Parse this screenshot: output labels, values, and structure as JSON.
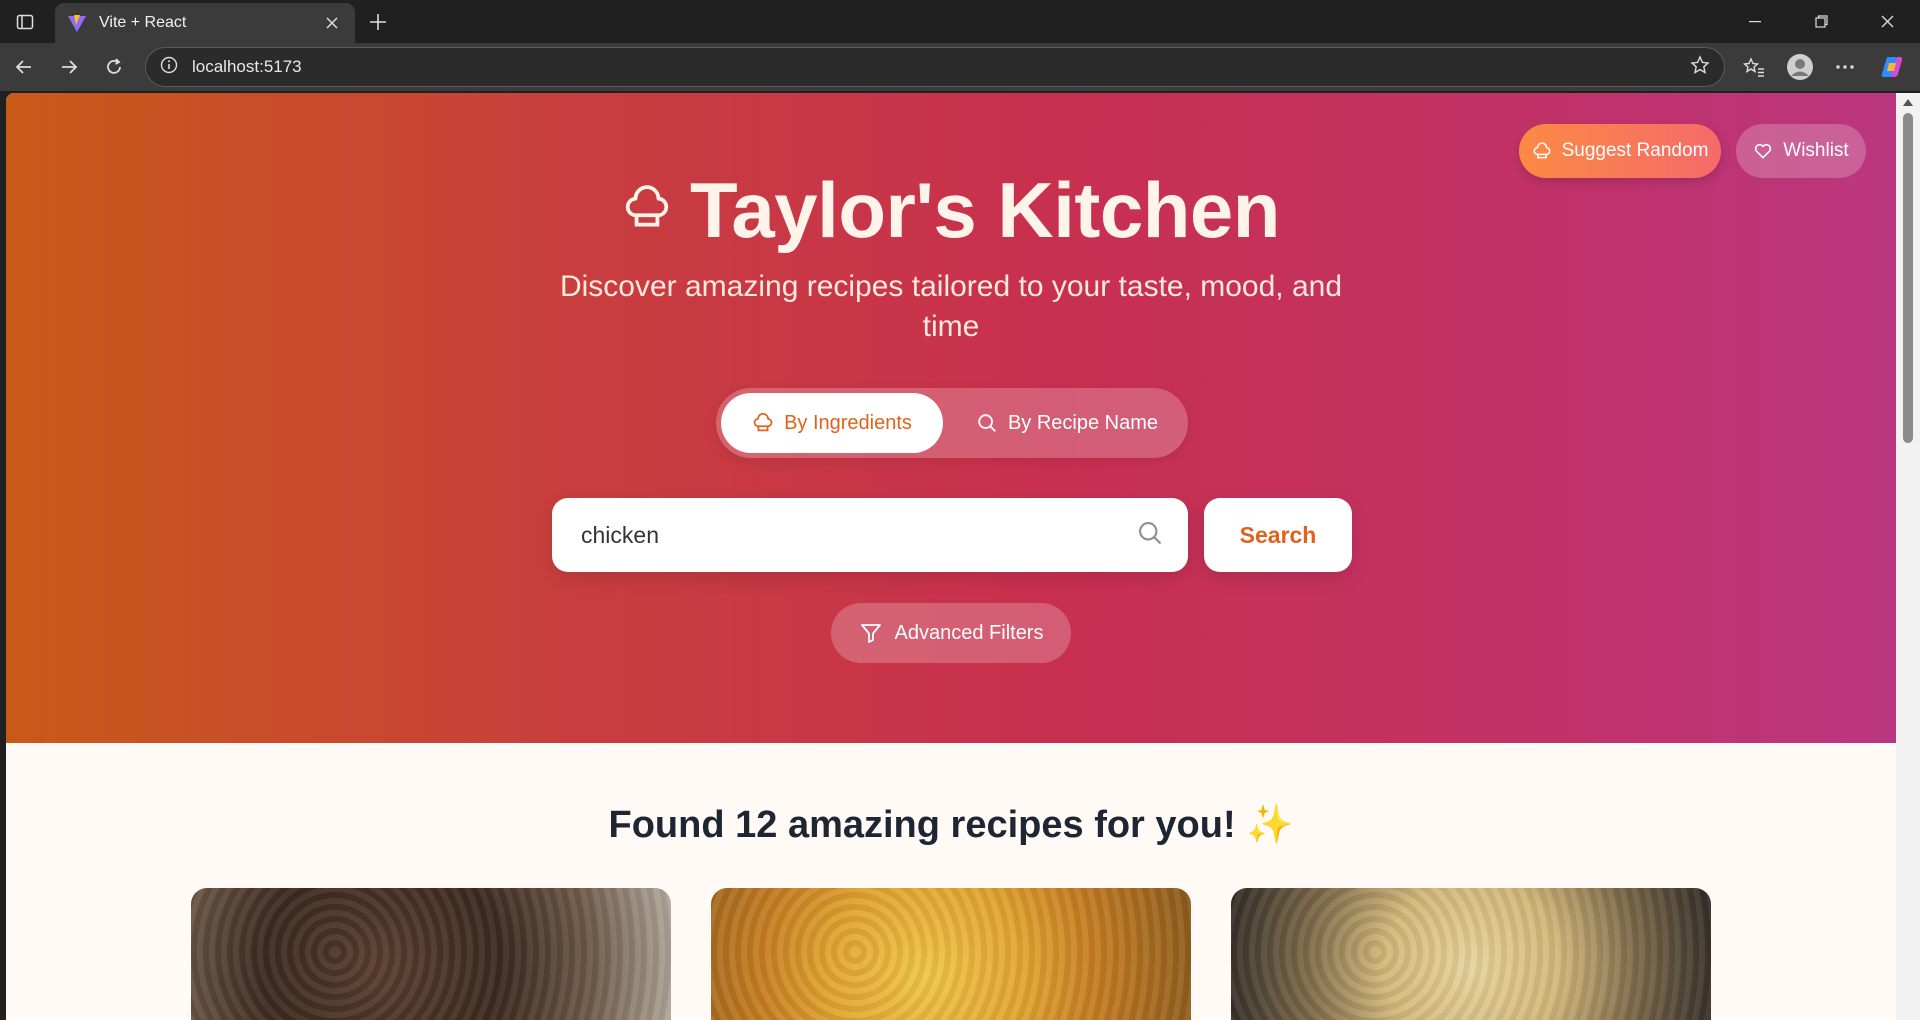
{
  "browser": {
    "tab_title": "Vite + React",
    "url": "localhost:5173"
  },
  "header": {
    "suggest_label": "Suggest Random",
    "wishlist_label": "Wishlist",
    "title": "Taylor's Kitchen",
    "subtitle": "Discover amazing recipes tailored to your taste, mood, and time"
  },
  "search_mode": {
    "options": [
      {
        "label": "By Ingredients",
        "icon": "chef-hat-icon",
        "selected": true
      },
      {
        "label": "By Recipe Name",
        "icon": "search-icon",
        "selected": false
      }
    ]
  },
  "search": {
    "value": "chicken",
    "button_label": "Search"
  },
  "filters": {
    "advanced_label": "Advanced Filters"
  },
  "results": {
    "heading": "Found 12 amazing recipes for you! ✨",
    "cards": [
      {
        "icon": "recipe-photo"
      },
      {
        "icon": "recipe-photo"
      },
      {
        "icon": "recipe-photo"
      }
    ]
  },
  "colors": {
    "accent": "#e2621d",
    "hero_start": "#c85a18",
    "hero_end": "#ba3680",
    "title_text": "#fff4ea",
    "heading_text": "#1e2533"
  }
}
